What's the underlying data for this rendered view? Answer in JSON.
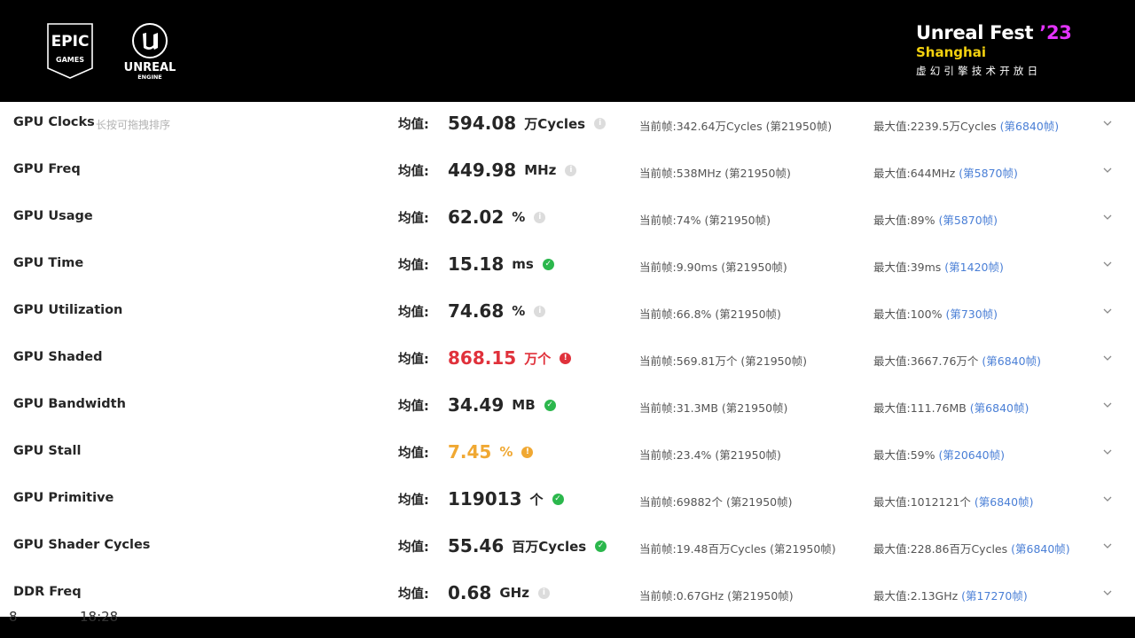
{
  "header": {
    "epic_text_line1": "EPIC",
    "epic_text_line2": "GAMES",
    "unreal_text_line1": "UNREAL",
    "unreal_text_line2": "ENGINE",
    "fest_title": "Unreal Fest ",
    "fest_year": "’23",
    "fest_city": "Shanghai",
    "fest_subtitle": "虚幻引擎技术开放日"
  },
  "colors": {
    "accent_link": "#4a7fd6",
    "ok": "#2bb74c",
    "error": "#e0313b",
    "warn": "#f0a832",
    "fest_year": "#e433ff",
    "fest_city": "#f3d10f"
  },
  "labels": {
    "avg": "均值:",
    "current": "当前帧:",
    "max": "最大值:",
    "drag_hint": "长按可拖拽排序"
  },
  "metrics": [
    {
      "name": "GPU Clocks",
      "avg": "594.08",
      "unit": "万Cycles",
      "status": "info",
      "current": "342.64万Cycles (第21950帧)",
      "max": "2239.5万Cycles ",
      "max_frame": "(第6840帧)"
    },
    {
      "name": "GPU Freq",
      "avg": "449.98",
      "unit": "MHz",
      "status": "info",
      "current": "538MHz (第21950帧)",
      "max": "644MHz ",
      "max_frame": "(第5870帧)"
    },
    {
      "name": "GPU Usage",
      "avg": "62.02",
      "unit": "%",
      "status": "info",
      "current": "74% (第21950帧)",
      "max": "89% ",
      "max_frame": "(第5870帧)"
    },
    {
      "name": "GPU Time",
      "avg": "15.18",
      "unit": "ms",
      "status": "ok",
      "current": "9.90ms (第21950帧)",
      "max": "39ms ",
      "max_frame": "(第1420帧)"
    },
    {
      "name": "GPU Utilization",
      "avg": "74.68",
      "unit": "%",
      "status": "info",
      "current": "66.8% (第21950帧)",
      "max": "100% ",
      "max_frame": "(第730帧)"
    },
    {
      "name": "GPU Shaded",
      "avg": "868.15",
      "unit": "万个",
      "status": "error",
      "current": "569.81万个 (第21950帧)",
      "max": "3667.76万个 ",
      "max_frame": "(第6840帧)"
    },
    {
      "name": "GPU Bandwidth",
      "avg": "34.49",
      "unit": "MB",
      "status": "ok",
      "current": "31.3MB (第21950帧)",
      "max": "111.76MB ",
      "max_frame": "(第6840帧)"
    },
    {
      "name": "GPU Stall",
      "avg": "7.45",
      "unit": "%",
      "status": "warn",
      "current": "23.4% (第21950帧)",
      "max": "59% ",
      "max_frame": "(第20640帧)"
    },
    {
      "name": "GPU Primitive",
      "avg": "119013",
      "unit": "个",
      "status": "ok",
      "current": "69882个 (第21950帧)",
      "max": "1012121个 ",
      "max_frame": "(第6840帧)"
    },
    {
      "name": "GPU Shader Cycles",
      "avg": "55.46",
      "unit": "百万Cycles",
      "status": "ok",
      "current": "19.48百万Cycles (第21950帧)",
      "max": "228.86百万Cycles ",
      "max_frame": "(第6840帧)"
    },
    {
      "name": "DDR Freq",
      "avg": "0.68",
      "unit": "GHz",
      "status": "info",
      "current": "0.67GHz (第21950帧)",
      "max": "2.13GHz ",
      "max_frame": "(第17270帧)"
    }
  ],
  "bottom": {
    "left_text": "8",
    "time_text": "18:28"
  }
}
